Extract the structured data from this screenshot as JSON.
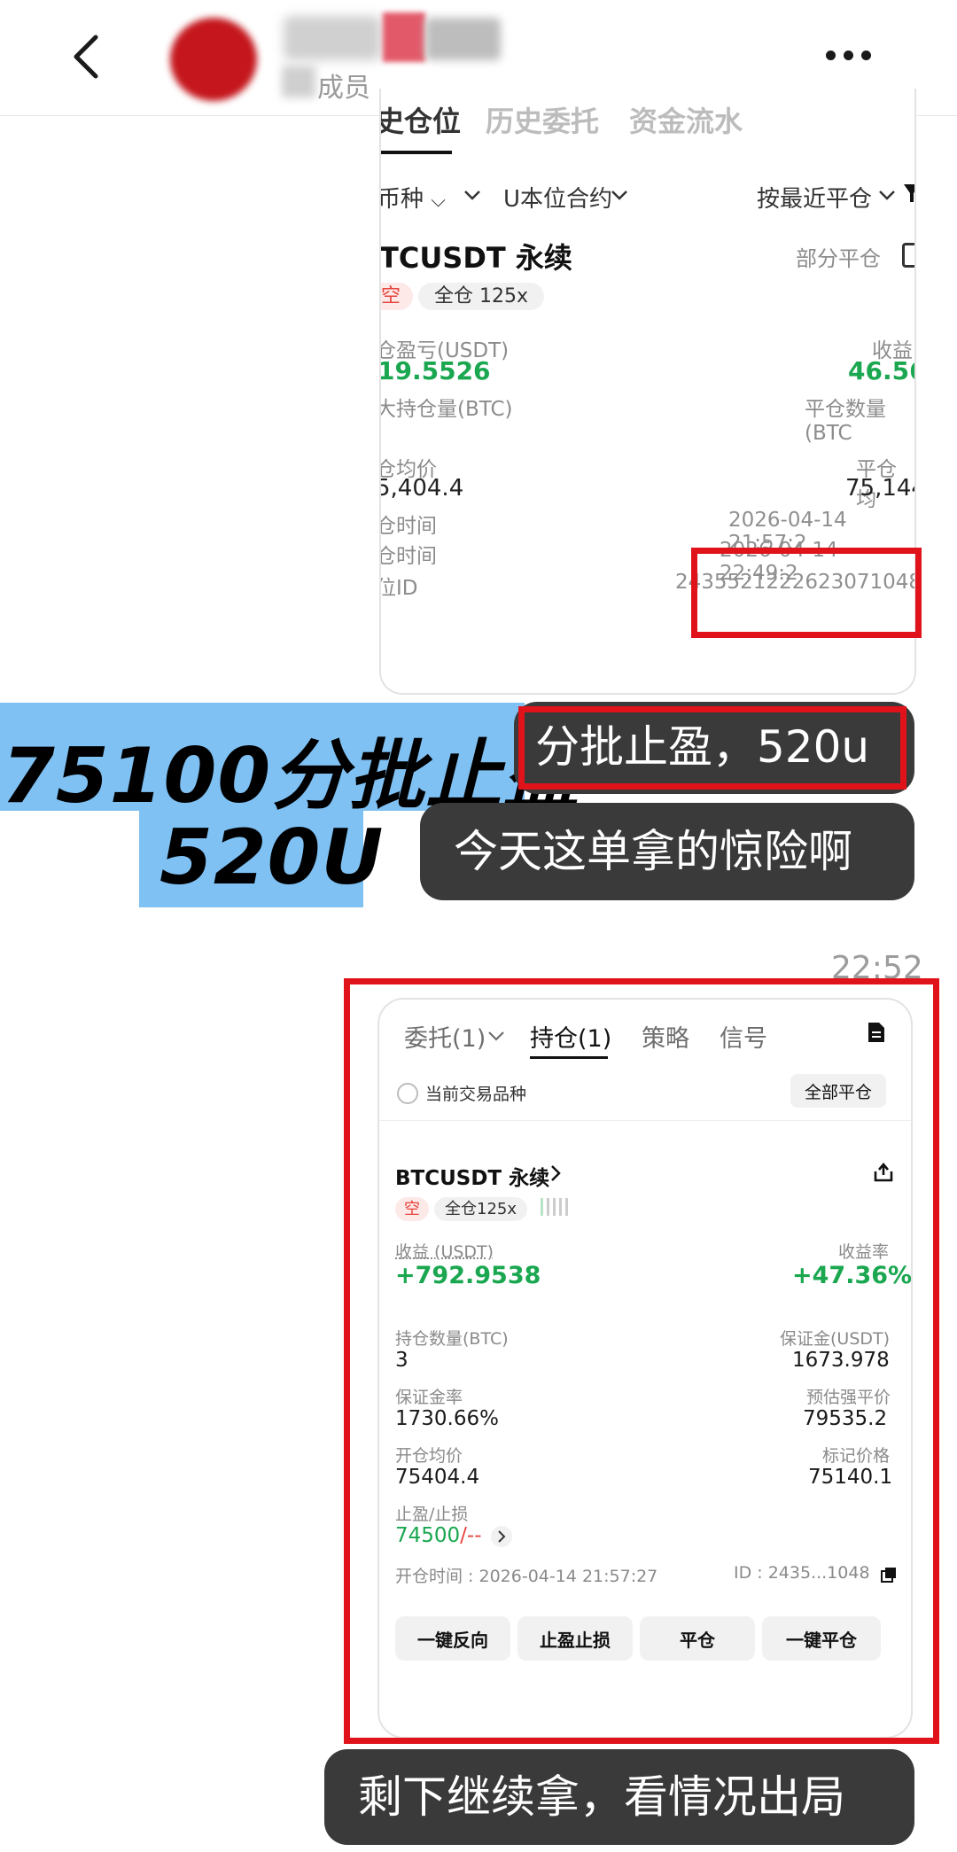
{
  "header": {
    "subtitle": "成员",
    "back_icon": "chevron-left-icon",
    "more_icon": "more-horizontal-icon"
  },
  "screenshot1": {
    "tabs": [
      "史仓位",
      "历史委托",
      "资金流水"
    ],
    "filters": {
      "currency": "币种",
      "contract": "U本位合约",
      "sort": "按最近平仓"
    },
    "symbol": "TCUSDT 永续",
    "status": "部分平仓",
    "tag_side": "空",
    "tag_margin": "全仓 125x",
    "pnl_label": "仓盈亏(USDT)",
    "pnl_value": "19.5526",
    "rate_label": "收益",
    "rate_value": "46.56",
    "maxhold_label": "大持仓量(BTC)",
    "closeqty_label": "平仓数量(BTC",
    "open_avg_label": "仓均价",
    "open_avg_value": "5,404.4",
    "close_avg_label": "平仓均",
    "close_avg_value": "75,144.",
    "open_time_label": "仓时间",
    "open_time_value": "2026-04-14 21:57:2",
    "close_time_label": "仓时间",
    "close_time_value": "2026-04-14 22:49:2",
    "position_id_label": "位ID",
    "position_id_value": "2435521222623071048"
  },
  "caption": {
    "line1": "75100分批止盈",
    "line2": "520U",
    "bg_color": "#7fc1f3"
  },
  "messages": [
    {
      "text": "分批止盈，520u"
    },
    {
      "text": "今天这单拿的惊险啊"
    },
    {
      "text": "剩下继续拿，看情况出局"
    }
  ],
  "timestamp": "22:52",
  "screenshot2": {
    "tabs": {
      "orders": "委托(1)",
      "positions": "持仓(1)",
      "strategy": "策略",
      "signals": "信号"
    },
    "current_pair_label": "当前交易品种",
    "close_all_label": "全部平仓",
    "symbol": "BTCUSDT 永续",
    "tag_side": "空",
    "tag_margin": "全仓125x",
    "pnl_label": "收益 (USDT)",
    "pnl_value": "+792.9538",
    "rate_label": "收益率",
    "rate_value": "+47.36%",
    "qty_label": "持仓数量(BTC)",
    "qty_value": "3",
    "margin_label": "保证金(USDT)",
    "margin_value": "1673.978",
    "margin_rate_label": "保证金率",
    "margin_rate_value": "1730.66%",
    "liq_label": "预估强平价",
    "liq_value": "79535.2",
    "open_avg_label": "开仓均价",
    "open_avg_value": "75404.4",
    "mark_label": "标记价格",
    "mark_value": "75140.1",
    "tpsl_label": "止盈/止损",
    "tp_value": "74500",
    "sl_value": "/--",
    "open_time": "开仓时间 : 2026-04-14 21:57:27",
    "id_text": "ID : 2435...1048",
    "buttons": [
      "一键反向",
      "止盈止损",
      "平仓",
      "一键平仓"
    ]
  },
  "colors": {
    "green": "#1aa750",
    "red_sell": "#e6443d",
    "annotation_red": "#e0131b",
    "bubble": "#3a3a3a"
  }
}
